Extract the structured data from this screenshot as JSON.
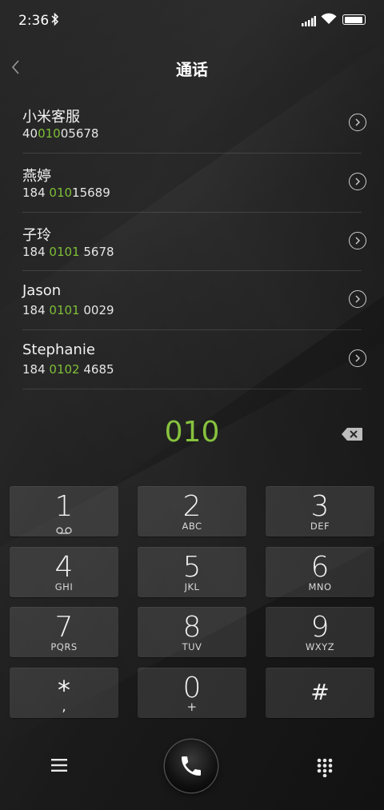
{
  "status_bar": {
    "time": "2:36"
  },
  "header": {
    "title": "通话"
  },
  "contacts": [
    {
      "name": "小米客服",
      "num_before": "40",
      "num_match": "010",
      "num_after": "05678"
    },
    {
      "name": "燕婷",
      "num_before": "184 ",
      "num_match": "010",
      "num_after": "15689"
    },
    {
      "name": "子玲",
      "num_before": "184 ",
      "num_match": "0101",
      "num_after": " 5678"
    },
    {
      "name": "Jason",
      "num_before": "184 ",
      "num_match": "0101",
      "num_after": " 0029"
    },
    {
      "name": "Stephanie",
      "num_before": "184 ",
      "num_match": "0102",
      "num_after": " 4685"
    }
  ],
  "dialed_number": "010",
  "keypad": {
    "k1": {
      "digit": "1",
      "letters": ""
    },
    "k2": {
      "digit": "2",
      "letters": "ABC"
    },
    "k3": {
      "digit": "3",
      "letters": "DEF"
    },
    "k4": {
      "digit": "4",
      "letters": "GHI"
    },
    "k5": {
      "digit": "5",
      "letters": "JKL"
    },
    "k6": {
      "digit": "6",
      "letters": "MNO"
    },
    "k7": {
      "digit": "7",
      "letters": "PQRS"
    },
    "k8": {
      "digit": "8",
      "letters": "TUV"
    },
    "k9": {
      "digit": "9",
      "letters": "WXYZ"
    },
    "kstar": {
      "digit": "*",
      "letters": ","
    },
    "k0": {
      "digit": "0",
      "letters": "+"
    },
    "khash": {
      "digit": "#",
      "letters": ""
    }
  },
  "colors": {
    "accent_green": "#86c23d",
    "match_green": "#7fbf38"
  },
  "icons": {
    "back": "chevron-left-icon",
    "row_action": "circle-chevron-right-icon",
    "delete": "backspace-icon",
    "voicemail": "voicemail-icon",
    "menu": "hamburger-menu-icon",
    "call": "phone-icon",
    "dialpad": "dialpad-icon"
  }
}
